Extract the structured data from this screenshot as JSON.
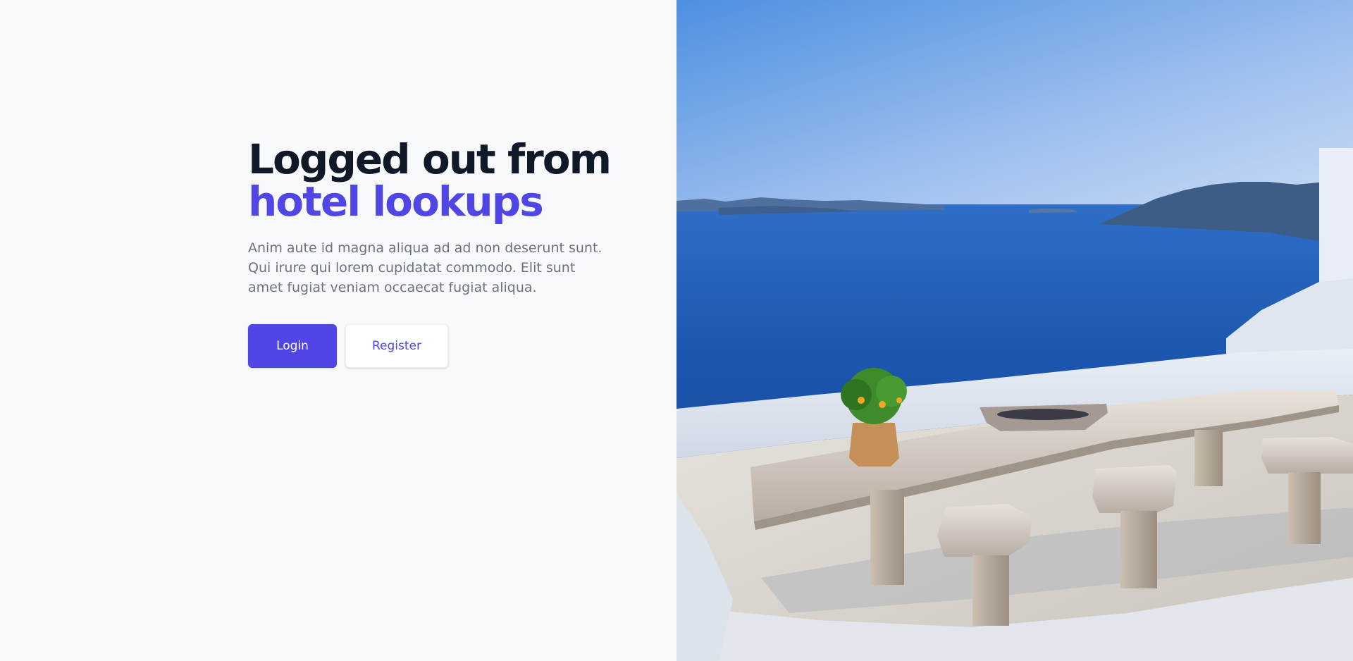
{
  "hero": {
    "title_line1": "Logged out from",
    "title_line2": "hotel lookups",
    "description": "Anim aute id magna aliqua ad ad non deserunt sunt. Qui irure qui lorem cupidatat commodo. Elit sunt amet fugiat veniam occaecat fugiat aliqua."
  },
  "actions": {
    "login_label": "Login",
    "register_label": "Register"
  },
  "colors": {
    "accent": "#4f46e5",
    "heading": "#111827",
    "body_text": "#6b7280",
    "background": "#f8f9fb"
  },
  "image": {
    "subject": "santorini-terrace-sea-view"
  }
}
